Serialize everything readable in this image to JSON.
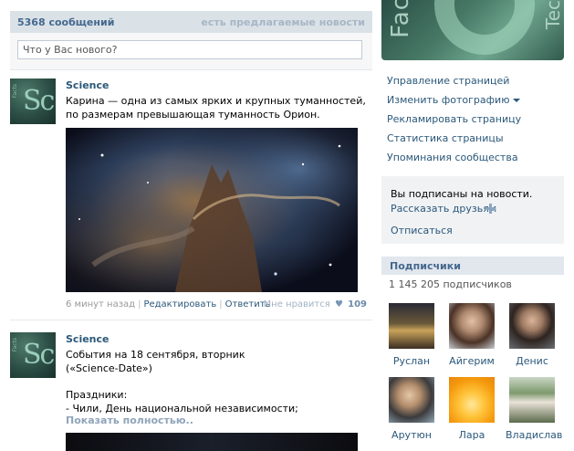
{
  "wall": {
    "count_label": "5368 сообщений",
    "suggested_label": "есть предлагаемые новости",
    "status_placeholder": "Что у Вас нового?"
  },
  "posts": [
    {
      "author": "Science",
      "text": "Карина — одна из самых ярких и крупных туманностей, по размерам превышающая туманность Орион.",
      "time": "6 минут назад",
      "edit_label": "Редактировать",
      "reply_label": "Ответить",
      "like_label": "Мне нравится",
      "like_count": "109"
    },
    {
      "author": "Science",
      "text_line1": "События на 18 сентября, вторник",
      "text_line2": "(«Science-Date»)",
      "text_line3": "Праздники:",
      "text_line4": "- Чили, День национальной независимости;",
      "show_more": "Показать полностью.."
    }
  ],
  "sidebar": {
    "actions": [
      "Управление страницей",
      "Изменить фотографию",
      "Рекламировать страницу",
      "Статистика страницы",
      "Упоминания сообщества"
    ],
    "subscribed_text": "Вы подписаны на новости.",
    "tell_friends": "Рассказать друзьям",
    "unsubscribe": "Отписаться",
    "followers_title": "Подписчики",
    "followers_count": "1 145 205 подписчиков",
    "followers": [
      {
        "name": "Руслан"
      },
      {
        "name": "Айгерим"
      },
      {
        "name": "Денис"
      },
      {
        "name": "Арутюн"
      },
      {
        "name": "Лара"
      },
      {
        "name": "Владислав"
      }
    ]
  },
  "colors": {
    "link": "#2b587a",
    "header_bg": "#dae2e8",
    "like_heart": "#7896b4"
  },
  "icons": [
    "heart-icon",
    "plus-icon",
    "caret-down-icon"
  ]
}
